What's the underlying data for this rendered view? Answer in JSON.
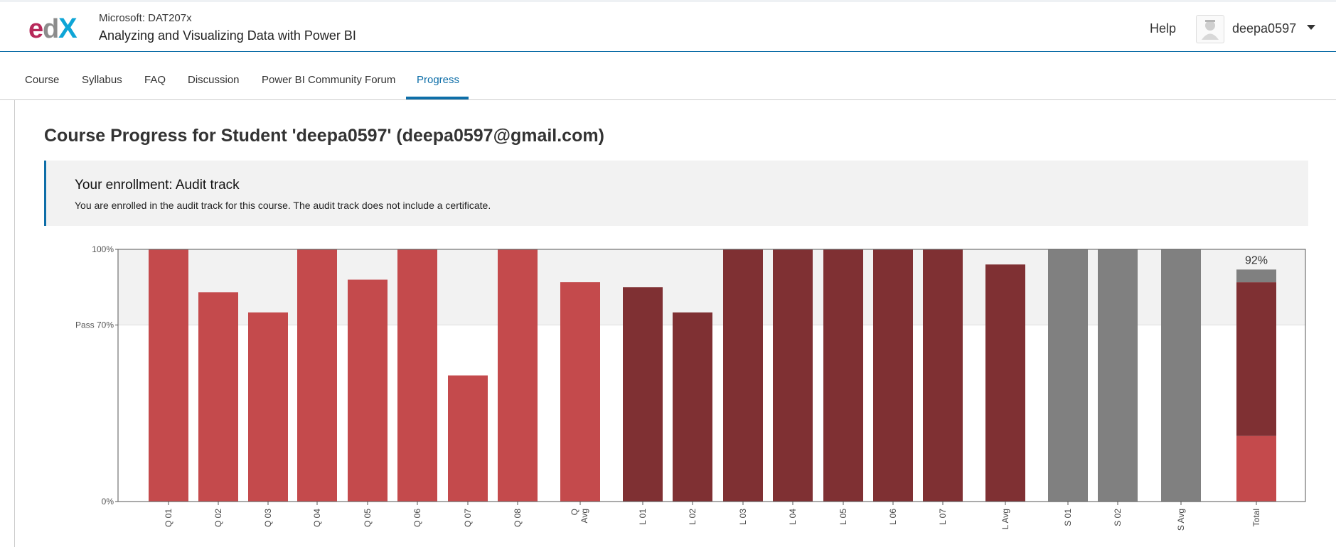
{
  "header": {
    "logo_text": "edX",
    "course_org": "Microsoft: DAT207x",
    "course_name": "Analyzing and Visualizing Data with Power BI",
    "help_label": "Help",
    "username": "deepa0597",
    "avatar_icon": "user-avatar-icon",
    "menu_icon": "caret-down-icon"
  },
  "tabs": [
    {
      "label": "Course",
      "active": false
    },
    {
      "label": "Syllabus",
      "active": false
    },
    {
      "label": "FAQ",
      "active": false
    },
    {
      "label": "Discussion",
      "active": false
    },
    {
      "label": "Power BI Community Forum",
      "active": false
    },
    {
      "label": "Progress",
      "active": true
    }
  ],
  "main": {
    "title": "Course Progress for Student 'deepa0597' (deepa0597@gmail.com)",
    "enrollment": {
      "title": "Your enrollment: Audit track",
      "message": "You are enrolled in the audit track for this course. The audit track does not include a certificate."
    }
  },
  "colors": {
    "accent": "#0e6ea8",
    "quiz": "#c44a4c",
    "lab": "#7f3033",
    "survey": "#808080",
    "pass_band": "#f2f2f2"
  },
  "chart_data": {
    "type": "bar",
    "ylim": [
      0,
      100
    ],
    "yticks": [
      {
        "value": 0,
        "label": "0%"
      },
      {
        "value": 70,
        "label": "Pass 70%"
      },
      {
        "value": 100,
        "label": "100%"
      }
    ],
    "pass_line": 70,
    "categories": [
      "Q 01",
      "Q 02",
      "Q 03",
      "Q 04",
      "Q 05",
      "Q 06",
      "Q 07",
      "Q 08",
      "Q Avg",
      "L 01",
      "L 02",
      "L 03",
      "L 04",
      "L 05",
      "L 06",
      "L 07",
      "L Avg",
      "S 01",
      "S 02",
      "S Avg",
      "Total"
    ],
    "series": [
      {
        "group": "quiz",
        "values": [
          100,
          83,
          75,
          100,
          88,
          100,
          50,
          100,
          87
        ]
      },
      {
        "group": "lab",
        "values": [
          85,
          75,
          100,
          100,
          100,
          100,
          100,
          94
        ]
      },
      {
        "group": "survey",
        "values": [
          100,
          100,
          100
        ]
      }
    ],
    "total": {
      "label": "92%",
      "value": 92,
      "segments": [
        {
          "group": "quiz",
          "value": 26
        },
        {
          "group": "lab",
          "value": 61
        },
        {
          "group": "survey",
          "value": 5
        }
      ]
    }
  }
}
